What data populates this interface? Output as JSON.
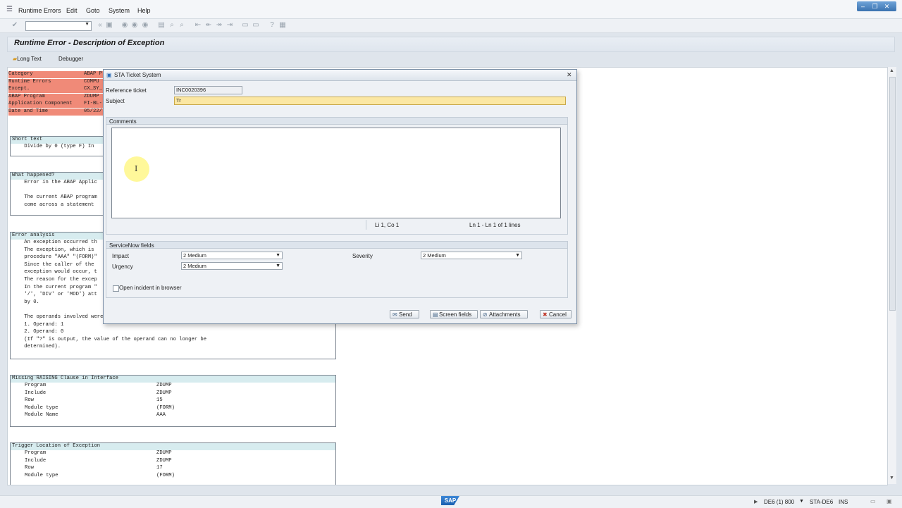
{
  "menu": {
    "items": [
      "Runtime Errors",
      "Edit",
      "Goto",
      "System",
      "Help"
    ]
  },
  "window_controls": [
    "–",
    "❐",
    "✕"
  ],
  "page": {
    "title": "Runtime Error - Description of Exception",
    "app_buttons": [
      "Long Text",
      "Debugger"
    ]
  },
  "header_rows": [
    {
      "label": "Category",
      "value": "ABAP P"
    },
    {
      "label": "Runtime Errors",
      "value": "COMPU"
    },
    {
      "label": "Except.",
      "value": "CX_SY_"
    },
    {
      "label": "ABAP Program",
      "value": "ZDUMP"
    },
    {
      "label": "Application Component",
      "value": "FI-BL-"
    },
    {
      "label": "Date and Time",
      "value": "05/22/"
    }
  ],
  "sections": {
    "short_text": {
      "title": "Short text",
      "lines": [
        "    Divide by 0 (type F) In"
      ]
    },
    "what_happened": {
      "title": "What happened?",
      "lines": [
        "    Error in the ABAP Applic",
        "",
        "    The current ABAP program",
        "    come across a statement"
      ]
    },
    "error_analysis": {
      "title": "Error analysis",
      "lines": [
        "    An exception occurred th",
        "    The exception, which is",
        "    procedure \"AAA\" \"(FORM)\"",
        "    Since the caller of the",
        "    exception would occur, t",
        "    The reason for the excep",
        "    In the current program \"",
        "    '/', 'DIV' or 'MOD') att",
        "    by 0.",
        "",
        "    The operands involved were:",
        "    1. Operand: 1",
        "    2. Operand: 0",
        "    (If \"?\" is output, the value of the operand can no longer be",
        "    determined)."
      ]
    },
    "missing_raising": {
      "title": "Missing RAISING Clause in Interface",
      "rows": [
        {
          "k": "Program",
          "v": "ZDUMP"
        },
        {
          "k": "Include",
          "v": "ZDUMP"
        },
        {
          "k": "Row",
          "v": "15"
        },
        {
          "k": "Module type",
          "v": "(FORM)"
        },
        {
          "k": "Module Name",
          "v": "AAA"
        }
      ]
    },
    "trigger_location": {
      "title": "Trigger Location of Exception",
      "rows": [
        {
          "k": "Program",
          "v": "ZDUMP"
        },
        {
          "k": "Include",
          "v": "ZDUMP"
        },
        {
          "k": "Row",
          "v": "17"
        },
        {
          "k": "Module type",
          "v": "(FORM)"
        }
      ]
    }
  },
  "dialog": {
    "title": "STA Ticket System",
    "reference_label": "Reference ticket",
    "reference_value": "INC0020396",
    "subject_label": "Subject",
    "subject_value": "Tr",
    "comments_label": "Comments",
    "editor_pos": "Li 1, Co 1",
    "editor_lines": "Ln 1 - Ln 1 of 1 lines",
    "servicenow_label": "ServiceNow fields",
    "impact_label": "Impact",
    "impact_value": "2 Medium",
    "urgency_label": "Urgency",
    "urgency_value": "2 Medium",
    "severity_label": "Severity",
    "severity_value": "2 Medium",
    "open_browser_label": "Open incident in browser",
    "buttons": {
      "send": "Send",
      "screen_fields": "Screen fields",
      "attachments": "Attachments",
      "cancel": "Cancel"
    }
  },
  "status": {
    "system": "DE6 (1) 800",
    "server": "STA-DE6",
    "mode": "INS",
    "logo": "SAP"
  },
  "colors": {
    "header_red": "#f08a78",
    "section_header": "#d7ecef",
    "subject_highlight": "#fbe7a3"
  }
}
